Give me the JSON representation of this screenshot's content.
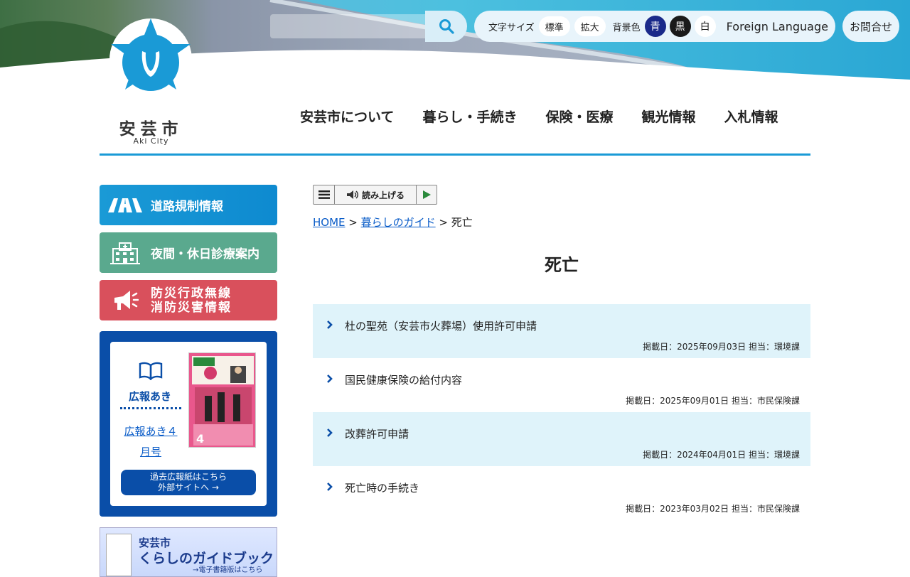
{
  "header": {
    "search": {
      "placeholder": ""
    },
    "utility": {
      "font_size_label": "文字サイズ",
      "font_standard": "標準",
      "font_large": "拡大",
      "bg_color_label": "背景色",
      "bg_blue": "青",
      "bg_black": "黒",
      "bg_white": "白",
      "foreign_language": "Foreign Language"
    },
    "contact": "お問合せ",
    "logo": {
      "name": "安芸市",
      "sub": "Aki City"
    }
  },
  "gnav": [
    {
      "label": "安芸市について"
    },
    {
      "label": "暮らし・手続き"
    },
    {
      "label": "保険・医療"
    },
    {
      "label": "観光情報"
    },
    {
      "label": "入札情報"
    }
  ],
  "side": {
    "road": "道路規制情報",
    "hospital": "夜間・休日診療案内",
    "disaster_line1": "防災行政無線",
    "disaster_line2": "消防災害情報",
    "kouhou": {
      "title": "広報あき",
      "link_line1": "広報あき４",
      "link_line2": "月号",
      "past_line1": "過去広報紙はこちら",
      "past_line2": "外部サイトへ →"
    },
    "guidebook": {
      "line1": "安芸市",
      "line2": "くらしのガイドブック",
      "line3": "→電子書籍版はこちら"
    }
  },
  "main": {
    "readbar": {
      "label": "読み上げる"
    },
    "breadcrumb": {
      "home": "HOME",
      "sep1": " > ",
      "parent": "暮らしのガイド",
      "sep2": " > ",
      "current": "死亡"
    },
    "title": "死亡",
    "items": [
      {
        "title": "杜の聖苑（安芸市火葬場）使用許可申請",
        "meta": "掲載日：2025年09月03日 担当：環境課"
      },
      {
        "title": "国民健康保険の給付内容",
        "meta": "掲載日：2025年09月01日 担当：市民保険課"
      },
      {
        "title": "改葬許可申請",
        "meta": "掲載日：2024年04月01日 担当：環境課"
      },
      {
        "title": "死亡時の手続き",
        "meta": "掲載日：2023年03月02日 担当：市民保険課"
      }
    ]
  },
  "colors": {
    "accent": "#1a9ad6",
    "road_button": "#1a9ad6",
    "hospital_button": "#5aa98e",
    "disaster_button": "#d9505c",
    "kouhou_bg": "#0a4ea8",
    "list_shade": "#dff3fa"
  }
}
